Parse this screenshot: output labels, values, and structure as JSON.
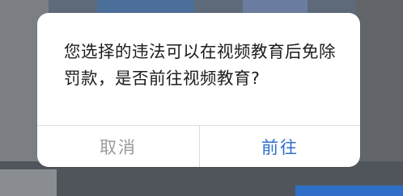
{
  "dialog": {
    "message": "您选择的违法可以在视频教育后免除罚款，是否前往视频教育?",
    "cancel_label": "取消",
    "confirm_label": "前往"
  },
  "colors": {
    "cancel_text": "#9a9a9a",
    "confirm_text": "#2f6fc9",
    "message_text": "#1c1c1c",
    "overlay": "#6b6f74"
  }
}
